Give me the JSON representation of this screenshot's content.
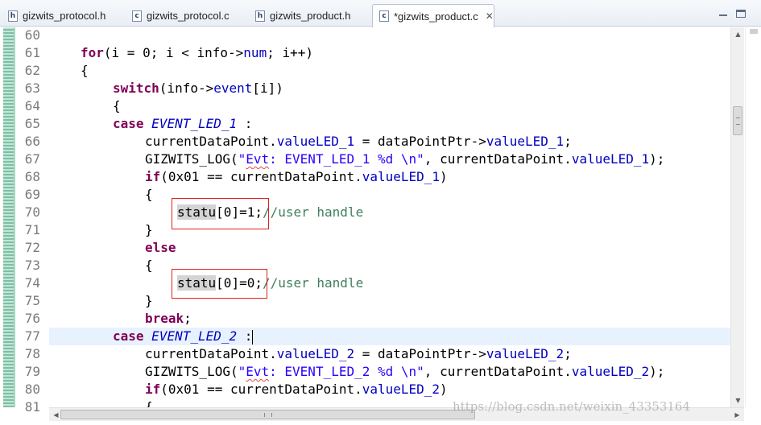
{
  "tabs": [
    {
      "label": "gizwits_protocol.h",
      "icon": "h"
    },
    {
      "label": "gizwits_protocol.c",
      "icon": "c"
    },
    {
      "label": "gizwits_product.h",
      "icon": "h"
    },
    {
      "label": "*gizwits_product.c",
      "icon": "c",
      "active": true
    }
  ],
  "editor": {
    "line_numbers": [
      "60",
      "61",
      "62",
      "63",
      "64",
      "65",
      "66",
      "67",
      "68",
      "69",
      "70",
      "71",
      "72",
      "73",
      "74",
      "75",
      "76",
      "77",
      "78",
      "79",
      "80",
      "81"
    ],
    "current_line": "77",
    "colors": {
      "keyword": "#7f0055",
      "field": "#0000c0",
      "string": "#2a00ff",
      "comment": "#3f7f5f",
      "current_line_bg": "#e8f2fe",
      "annotation_box": "#e02020"
    },
    "code": {
      "l61": {
        "a": "for",
        "b": "(i = 0; i < info->",
        "c": "num",
        "d": "; i++)"
      },
      "l62": "{",
      "l63": {
        "a": "switch",
        "b": "(info->",
        "c": "event",
        "d": "[i])"
      },
      "l64": "{",
      "l65": {
        "a": "case",
        "b": "EVENT_LED_1",
        "c": " :"
      },
      "l66": {
        "a": "currentDataPoint.",
        "b": "valueLED_1",
        "c": " = dataPointPtr->",
        "d": "valueLED_1",
        "e": ";"
      },
      "l67": {
        "a": "GIZWITS_LOG(",
        "b": "\"",
        "c": "Evt",
        "d": ": EVENT_LED_1 %d \\n\"",
        "e": ", currentDataPoint.",
        "f": "valueLED_1",
        "g": ");"
      },
      "l68": {
        "a": "if",
        "b": "(0x01 == currentDataPoint.",
        "c": "valueLED_1",
        "d": ")"
      },
      "l69": "{",
      "l70": {
        "a": "statu",
        "b": "[0]=1;",
        "c": "//user handle"
      },
      "l71": "}",
      "l72": "else",
      "l73": "{",
      "l74": {
        "a": "statu",
        "b": "[0]=0;",
        "c": "//user handle"
      },
      "l75": "}",
      "l76": {
        "a": "break",
        "b": ";"
      },
      "l77": {
        "a": "case",
        "b": "EVENT_LED_2",
        "c": " :"
      },
      "l78": {
        "a": "currentDataPoint.",
        "b": "valueLED_2",
        "c": " = dataPointPtr->",
        "d": "valueLED_2",
        "e": ";"
      },
      "l79": {
        "a": "GIZWITS_LOG(",
        "b": "\"",
        "c": "Evt",
        "d": ": EVENT_LED_2 %d \\n\"",
        "e": ", currentDataPoint.",
        "f": "valueLED_2",
        "g": ");"
      },
      "l80": {
        "a": "if",
        "b": "(0x01 == currentDataPoint.",
        "c": "valueLED_2",
        "d": ")"
      },
      "l81": "{"
    }
  },
  "watermark": "https://blog.csdn.net/weixin_43353164",
  "icons": {
    "tab_file": "file-icon",
    "tab_close": "close-icon",
    "minimize": "minimize-icon",
    "maximize": "maximize-icon",
    "scroll_up": "arrow-up-icon",
    "scroll_down": "arrow-down-icon",
    "scroll_left": "arrow-left-icon",
    "scroll_right": "arrow-right-icon"
  }
}
